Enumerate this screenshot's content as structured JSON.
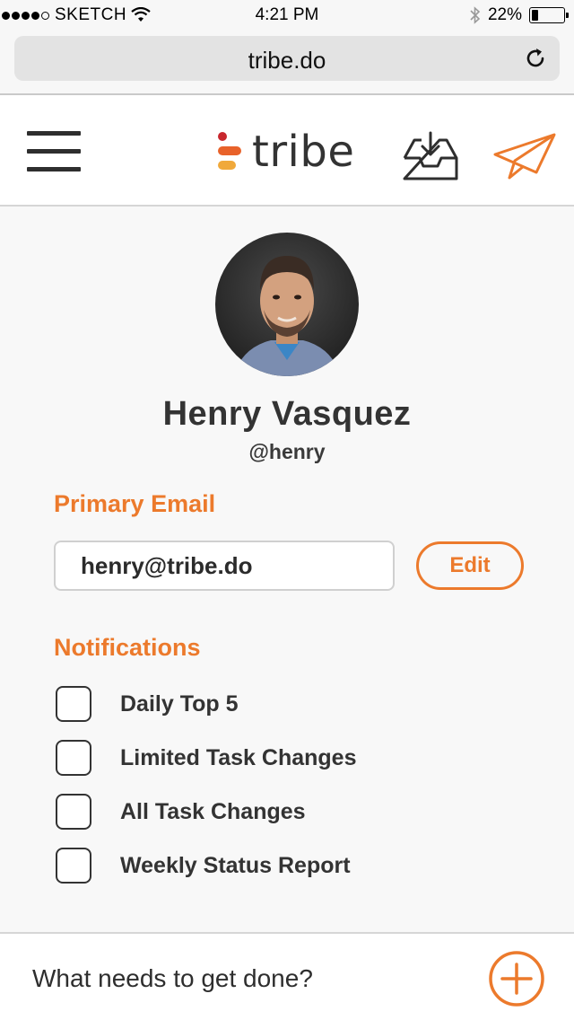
{
  "status_bar": {
    "carrier": "SKETCH",
    "time": "4:21 PM",
    "battery_percent": "22%",
    "battery_level": 0.22,
    "signal_bars_filled": 4,
    "signal_bars_total": 5
  },
  "browser": {
    "url": "tribe.do",
    "reload_icon": "reload-icon"
  },
  "header": {
    "logo_text": "tribe",
    "menu_icon": "hamburger-menu-icon",
    "inbox_icon": "inbox-download-icon",
    "send_icon": "paper-plane-icon"
  },
  "profile": {
    "name": "Henry Vasquez",
    "handle": "@henry"
  },
  "primary_email": {
    "label": "Primary Email",
    "value": "henry@tribe.do",
    "edit_label": "Edit"
  },
  "notifications": {
    "label": "Notifications",
    "items": [
      {
        "label": "Daily Top 5",
        "checked": false
      },
      {
        "label": "Limited Task Changes",
        "checked": false
      },
      {
        "label": "All Task Changes",
        "checked": false
      },
      {
        "label": "Weekly Status Report",
        "checked": false
      }
    ]
  },
  "task_bar": {
    "placeholder": "What needs to get done?",
    "add_icon": "plus-circle-icon"
  },
  "colors": {
    "accent": "#ec7a2c",
    "logo_red": "#c8272e",
    "logo_orange": "#e8622a",
    "logo_yellow": "#f0a93b"
  }
}
